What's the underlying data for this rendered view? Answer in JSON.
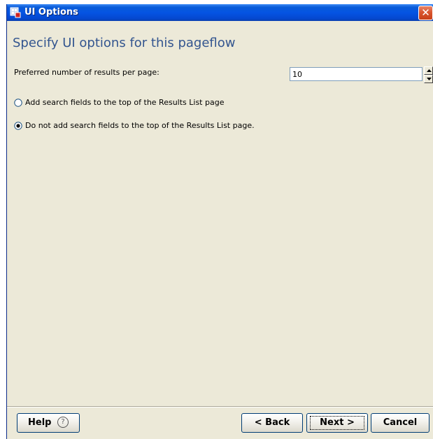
{
  "window": {
    "title": "UI Options",
    "close_glyph": "✕"
  },
  "page": {
    "heading": "Specify UI options for this pageflow"
  },
  "results_per_page": {
    "label": "Preferred number of results per page:",
    "value": "10"
  },
  "search_fields_options": [
    {
      "label": "Add search fields to the top of the Results List page",
      "selected": false
    },
    {
      "label": "Do not add search fields to the top of the Results List page.",
      "selected": true
    }
  ],
  "buttons": {
    "help": "Help",
    "help_icon": "?",
    "back": "< Back",
    "next": "Next >",
    "cancel": "Cancel"
  },
  "icons": {
    "title_icon": "wizard-app-icon",
    "close": "close-icon",
    "spin_up": "spin-up-arrow-icon",
    "spin_down": "spin-down-arrow-icon",
    "help": "help-question-icon"
  },
  "colors": {
    "titlebar": "#0554e3",
    "heading": "#33558f",
    "dialog_bg": "#ece9d8",
    "close_button": "#d9552e"
  }
}
